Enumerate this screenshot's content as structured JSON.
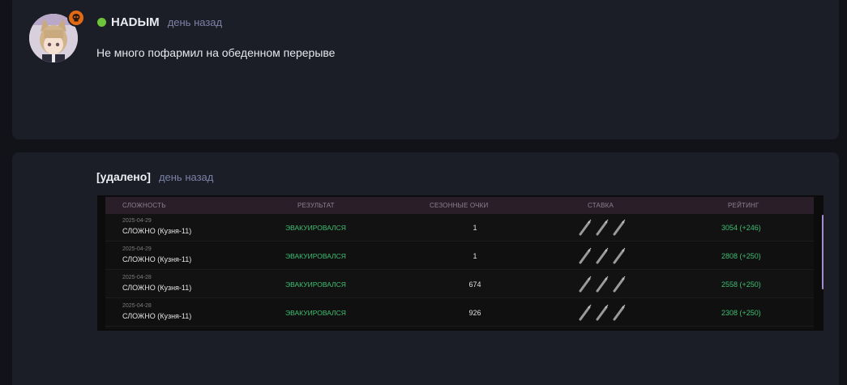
{
  "post": {
    "username": "HADЫM",
    "time": "день назад",
    "text": "Не много пофармил на обеденном перерыве"
  },
  "reply": {
    "author": "[удалено]",
    "time": "день назад"
  },
  "screenshot": {
    "headers": [
      "СЛОЖНОСТЬ",
      "РЕЗУЛЬТАТ",
      "СЕЗОННЫЕ ОЧКИ",
      "СТАВКА",
      "РЕЙТИНГ"
    ],
    "rows": [
      {
        "date": "2025-04-29",
        "difficulty": "СЛОЖНО (Кузня-11)",
        "result": "ЭВАКУИРОВАЛСЯ",
        "points": "1",
        "rating": "3054 (+246)"
      },
      {
        "date": "2025-04-29",
        "difficulty": "СЛОЖНО (Кузня-11)",
        "result": "ЭВАКУИРОВАЛСЯ",
        "points": "1",
        "rating": "2808 (+250)"
      },
      {
        "date": "2025-04-28",
        "difficulty": "СЛОЖНО (Кузня-11)",
        "result": "ЭВАКУИРОВАЛСЯ",
        "points": "674",
        "rating": "2558 (+250)"
      },
      {
        "date": "2025-04-28",
        "difficulty": "СЛОЖНО (Кузня-11)",
        "result": "ЭВАКУИРОВАЛСЯ",
        "points": "926",
        "rating": "2308 (+250)"
      }
    ]
  },
  "icons": {
    "badge": "skull-icon",
    "online": "online-status-icon",
    "stake": "syringe-icon"
  },
  "colors": {
    "background": "#121318",
    "card": "#1b1d27",
    "online": "#6fc33a",
    "badge": "#e26a14",
    "meta": "#7c82a6",
    "result_green": "#3fbf73"
  }
}
